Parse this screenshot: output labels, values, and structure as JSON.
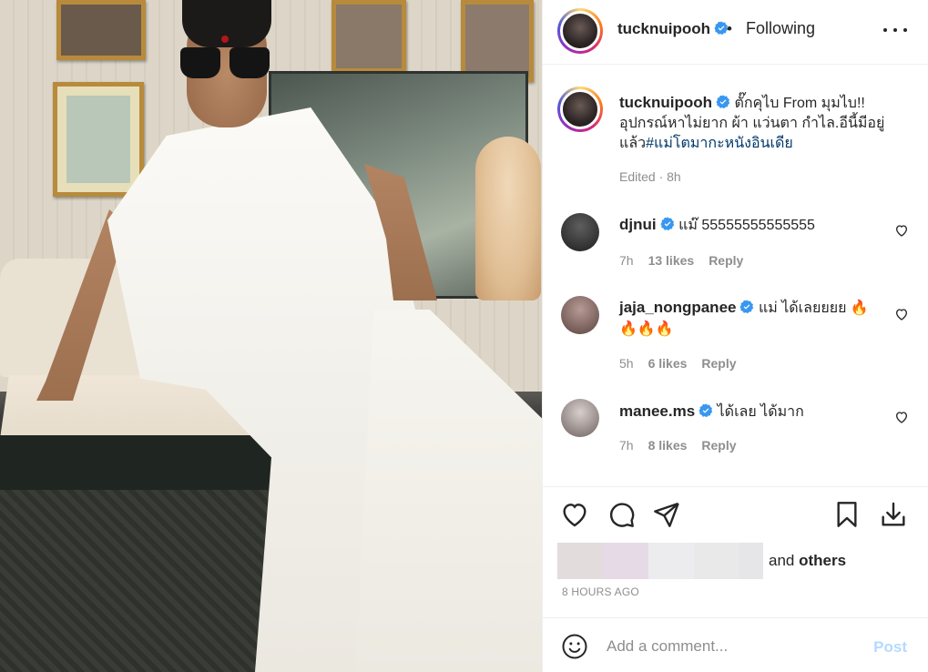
{
  "post": {
    "username": "tucknuipooh",
    "follow_status": "Following",
    "separator": "•"
  },
  "caption": {
    "username": "tucknuipooh",
    "text": "ตั๊กคุไบ From มุมไบ!! อุปกรณ์หาไม่ยาก ผ้า แว่นตา กำไล.อีนี้มีอยู่แล้ว",
    "hashtag": "#แม่โตมากะหนังอินเดีย",
    "meta": "Edited · 8h"
  },
  "comments": [
    {
      "username": "djnui",
      "text": "แม๊ 55555555555555",
      "time": "7h",
      "likes": "13 likes",
      "reply": "Reply",
      "avatar_color": "#3a3a3a"
    },
    {
      "username": "jaja_nongpanee",
      "text": "แม่ ได้เลยยยย 🔥🔥🔥🔥",
      "time": "5h",
      "likes": "6 likes",
      "reply": "Reply",
      "avatar_color": "#8a6f6a"
    },
    {
      "username": "manee.ms",
      "text": "ได้เลย ได้มาก",
      "time": "7h",
      "likes": "8 likes",
      "reply": "Reply",
      "avatar_color": "#9a8c88"
    }
  ],
  "liked_by": {
    "suffix_prefix": "and",
    "suffix_bold": "others",
    "blurred_colors": [
      "#e2dcdc",
      "#e5dae5",
      "#ececee",
      "#e9e9ea",
      "#e6e5e7"
    ]
  },
  "timestamp": "8 HOURS AGO",
  "comment_box": {
    "placeholder": "Add a comment...",
    "post_label": "Post"
  },
  "colors": {
    "verified": "#3897f0",
    "link": "#00376b",
    "muted": "#8e8e8e",
    "post_disabled": "#b3dbff"
  },
  "icons": [
    "more-options-icon",
    "verified-badge-icon",
    "heart-icon",
    "comment-icon",
    "share-icon",
    "bookmark-icon",
    "download-icon",
    "emoji-icon"
  ]
}
